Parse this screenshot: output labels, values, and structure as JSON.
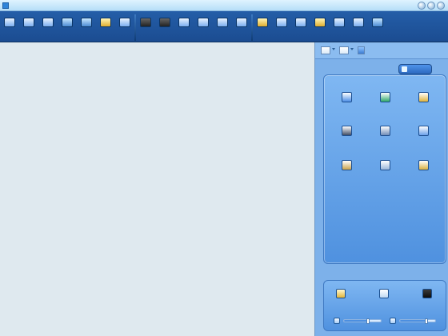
{
  "window": {
    "title": ""
  },
  "toolbar": {
    "items": [
      {
        "name": "tool-1",
        "label": ""
      },
      {
        "name": "tool-2",
        "label": ""
      },
      {
        "name": "tool-3",
        "label": ""
      },
      {
        "name": "tool-4",
        "label": ""
      },
      {
        "name": "tool-5",
        "label": ""
      },
      {
        "name": "tool-6",
        "label": ""
      },
      {
        "name": "tool-7",
        "label": ""
      },
      {
        "name": "tool-8",
        "label": ""
      },
      {
        "name": "tool-9",
        "label": ""
      },
      {
        "name": "tool-10",
        "label": ""
      },
      {
        "name": "tool-11",
        "label": ""
      },
      {
        "name": "tool-12",
        "label": ""
      },
      {
        "name": "tool-13",
        "label": ""
      },
      {
        "name": "tool-14",
        "label": ""
      },
      {
        "name": "tool-15",
        "label": ""
      },
      {
        "name": "tool-16",
        "label": ""
      },
      {
        "name": "tool-17",
        "label": ""
      },
      {
        "name": "tool-18",
        "label": ""
      },
      {
        "name": "tool-19",
        "label": ""
      },
      {
        "name": "tool-20",
        "label": ""
      }
    ]
  },
  "sidebar": {
    "tab_label": "",
    "launchers": [
      {
        "label": "",
        "color": "#4d8fe6"
      },
      {
        "label": "",
        "color": "#2fa86a"
      },
      {
        "label": "",
        "color": "#dfb23a"
      },
      {
        "label": "",
        "color": "#3f4c64"
      },
      {
        "label": "",
        "color": "#6f8cb8"
      },
      {
        "label": "",
        "color": "#6aa0ea"
      },
      {
        "label": "",
        "color": "#c9a24a"
      },
      {
        "label": "",
        "color": "#9bb6d9"
      },
      {
        "label": "",
        "color": "#d9b040"
      }
    ],
    "bottom_items": [
      {
        "label": ""
      },
      {
        "label": ""
      },
      {
        "label": ""
      }
    ],
    "audio": {
      "speaker_level": 0.65,
      "mic_level": 0.75
    }
  }
}
